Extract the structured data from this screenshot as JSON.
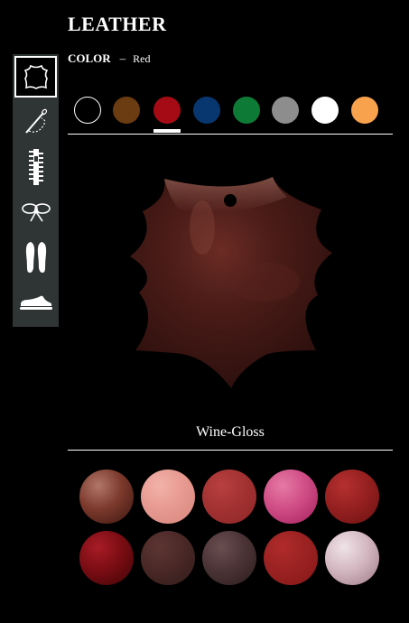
{
  "header": {
    "title": "LEATHER"
  },
  "color_selector": {
    "label": "COLOR",
    "separator": "–",
    "selected_value": "Red",
    "swatches": [
      {
        "name": "black",
        "color": "#000000"
      },
      {
        "name": "brown",
        "color": "#6b3b12"
      },
      {
        "name": "red",
        "color": "#a50b14",
        "selected": true
      },
      {
        "name": "blue",
        "color": "#08376f"
      },
      {
        "name": "green",
        "color": "#0d7a36"
      },
      {
        "name": "gray",
        "color": "#8d8d8d"
      },
      {
        "name": "white",
        "color": "#ffffff"
      },
      {
        "name": "orange",
        "color": "#f9a24d"
      }
    ]
  },
  "sidebar": {
    "items": [
      {
        "name": "leather-hide-icon",
        "active": true
      },
      {
        "name": "needle-thread-icon"
      },
      {
        "name": "zipper-icon"
      },
      {
        "name": "lace-bow-icon"
      },
      {
        "name": "insoles-icon"
      },
      {
        "name": "sneaker-icon"
      }
    ]
  },
  "preview": {
    "material_name": "Wine-Gloss"
  },
  "textures": [
    {
      "name": "wine-gloss",
      "colors": [
        "#3a1512",
        "#7d3a2c",
        "#b0776a"
      ]
    },
    {
      "name": "pink-smooth",
      "colors": [
        "#d6867d",
        "#e79a91",
        "#f2b2a9"
      ]
    },
    {
      "name": "red-matte",
      "colors": [
        "#8d2527",
        "#a33232",
        "#b84040"
      ]
    },
    {
      "name": "magenta-crinkle",
      "colors": [
        "#a4205d",
        "#d04d86",
        "#e57aa5"
      ]
    },
    {
      "name": "red-grain",
      "colors": [
        "#6d1111",
        "#962020",
        "#b53030"
      ]
    },
    {
      "name": "red-croc",
      "colors": [
        "#3e0507",
        "#7b0d14",
        "#a81c25"
      ]
    },
    {
      "name": "dark-brown-smooth",
      "colors": [
        "#2f1a19",
        "#4a2927",
        "#5d3533"
      ]
    },
    {
      "name": "brown-snake",
      "colors": [
        "#2b1c1d",
        "#4c3436",
        "#6a4e50"
      ]
    },
    {
      "name": "crimson-smooth",
      "colors": [
        "#851717",
        "#9b2222",
        "#b02b2b"
      ]
    },
    {
      "name": "pink-python",
      "colors": [
        "#9e7b86",
        "#d4b8c1",
        "#efe3e7"
      ]
    }
  ]
}
